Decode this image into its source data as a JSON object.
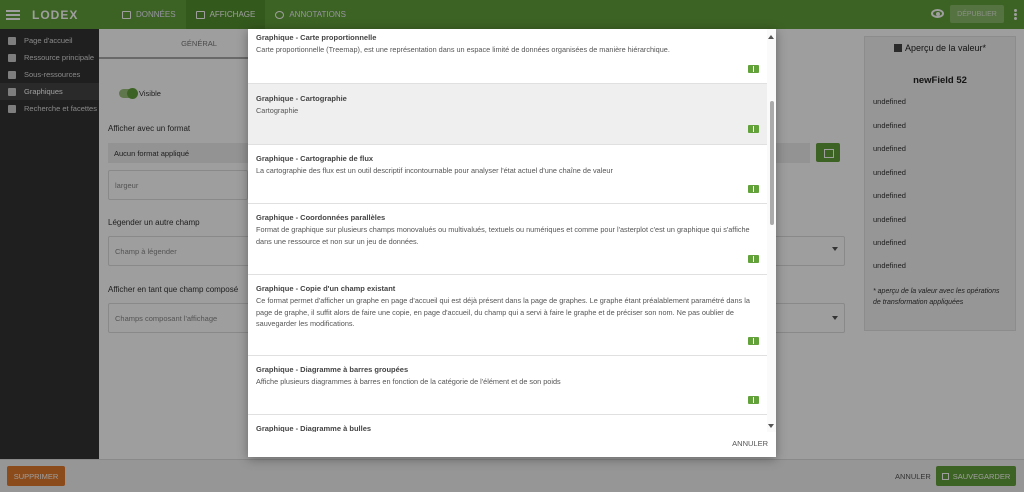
{
  "app": {
    "brand": "LODEX",
    "tabs": [
      {
        "label": "DONNÉES",
        "icon": "database-icon"
      },
      {
        "label": "AFFICHAGE",
        "icon": "display-icon"
      },
      {
        "label": "ANNOTATIONS",
        "icon": "annotation-icon"
      }
    ],
    "publish_label": "DÉPUBLIER"
  },
  "sidebar": {
    "items": [
      {
        "label": "Page d'accueil",
        "icon": "home-icon"
      },
      {
        "label": "Ressource principale",
        "icon": "document-icon"
      },
      {
        "label": "Sous-ressources",
        "icon": "list-icon"
      },
      {
        "label": "Graphiques",
        "icon": "chart-icon"
      },
      {
        "label": "Recherche et facettes",
        "icon": "search-icon"
      }
    ]
  },
  "main": {
    "subtab": "GÉNÉRAL",
    "visible_label": "Visible",
    "format_heading": "Afficher avec un format",
    "format_value": "Aucun format appliqué",
    "width_placeholder": "largeur",
    "caption_heading": "Légender un autre champ",
    "caption_placeholder": "Champ à légender",
    "composite_heading": "Afficher en tant que champ composé",
    "composite_placeholder": "Champs composant l'affichage"
  },
  "preview": {
    "title": "Aperçu de la valeur*",
    "field_name": "newField 52",
    "values": [
      "undefined",
      "undefined",
      "undefined",
      "undefined",
      "undefined",
      "undefined",
      "undefined",
      "undefined"
    ],
    "note": "* aperçu de la valeur avec les opérations de transformation appliquées"
  },
  "modal": {
    "items": [
      {
        "title": "Graphique - Carte proportionnelle",
        "description": "Carte proportionnelle (Treemap), est une représentation dans un espace limité de données organisées de manière hiérarchique."
      },
      {
        "title": "Graphique - Cartographie",
        "description": "Cartographie"
      },
      {
        "title": "Graphique - Cartographie de flux",
        "description": "La cartographie des flux est un outil descriptif incontournable pour analyser l'état actuel d'une chaîne de valeur"
      },
      {
        "title": "Graphique - Coordonnées parallèles",
        "description": "Format de graphique sur plusieurs champs monovalués ou multivalués, textuels ou numériques et comme pour l'asterplot c'est un graphique qui s'affiche dans une ressource et non sur un jeu de données."
      },
      {
        "title": "Graphique - Copie d'un champ existant",
        "description": "Ce format permet d'afficher un graphe en page d'accueil qui est déjà présent dans la page de graphes. Le graphe étant préalablement paramétré dans la page de graphe, il suffit alors de faire une copie, en page d'accueil, du champ qui a servi à faire le graphe et de préciser son nom. Ne pas oublier de sauvegarder les modifications."
      },
      {
        "title": "Graphique - Diagramme à barres groupées",
        "description": "Affiche plusieurs diagrammes à barres en fonction de la catégorie de l'élément et de son poids"
      },
      {
        "title": "Graphique - Diagramme à bulles",
        "description": ""
      }
    ],
    "cancel_label": "ANNULER"
  },
  "footer": {
    "delete_label": "SUPPRIMER",
    "cancel_label": "ANNULER",
    "save_label": "SAUVEGARDER"
  }
}
